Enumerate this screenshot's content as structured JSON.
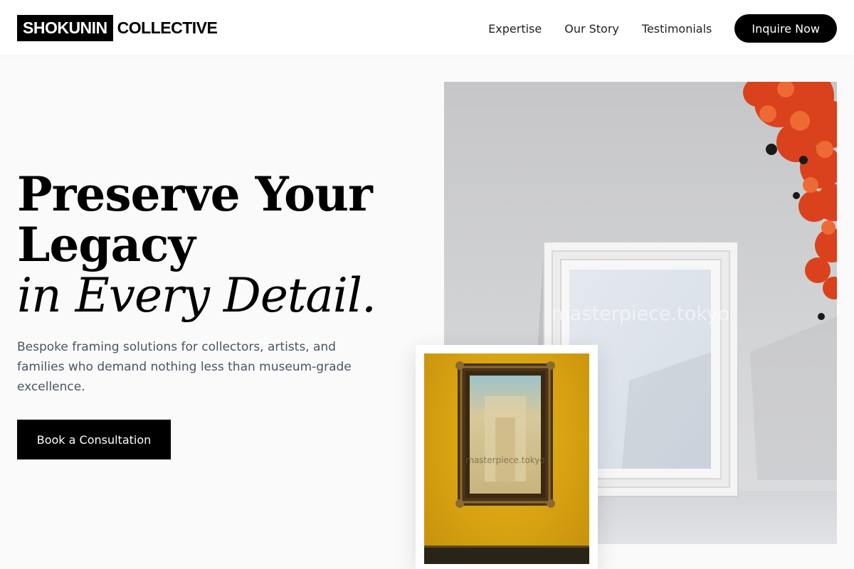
{
  "brand": {
    "name_box": "SHOKUNIN",
    "name_text": "COLLECTIVE"
  },
  "nav": {
    "links": [
      "Expertise",
      "Our Story",
      "Testimonials"
    ],
    "cta_label": "Inquire Now"
  },
  "hero": {
    "title_line1": "Preserve Your",
    "title_line2": "Legacy",
    "title_italic": "in Every Detail.",
    "subtitle": "Bespoke framing solutions for collectors, artists, and families who demand nothing less than museum-grade excellence.",
    "cta_label": "Book a Consultation"
  },
  "images": {
    "main_watermark": "masterpiece.tokyo",
    "card_watermark": "masterpiece.tokyo"
  },
  "colors": {
    "accent": "#000000",
    "background": "#fafafa",
    "subtitle_text": "#4a5563",
    "maple_red": "#d9421c",
    "card_gold": "#d8a312"
  }
}
